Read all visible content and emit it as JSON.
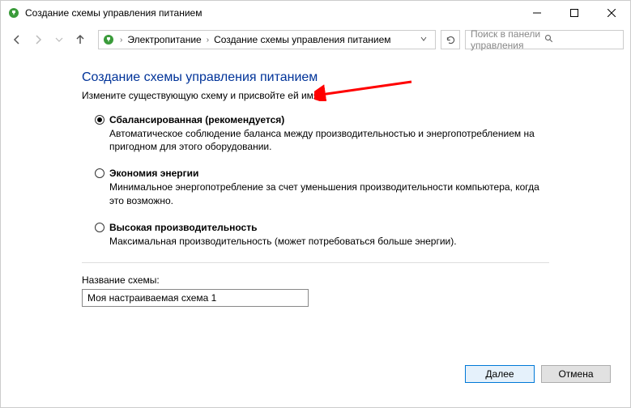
{
  "window": {
    "title": "Создание схемы управления питанием"
  },
  "breadcrumb": {
    "item1": "Электропитание",
    "item2": "Создание схемы управления питанием"
  },
  "search": {
    "placeholder": "Поиск в панели управления"
  },
  "page": {
    "title": "Создание схемы управления питанием",
    "subtitle": "Измените существующую схему и присвойте ей имя."
  },
  "plans": [
    {
      "name": "Сбалансированная (рекомендуется)",
      "desc": "Автоматическое соблюдение баланса между производительностью и энергопотреблением на пригодном для этого оборудовании.",
      "checked": true
    },
    {
      "name": "Экономия энергии",
      "desc": "Минимальное энергопотребление за счет уменьшения производительности компьютера, когда это возможно.",
      "checked": false
    },
    {
      "name": "Высокая производительность",
      "desc": "Максимальная производительность (может потребоваться больше энергии).",
      "checked": false
    }
  ],
  "schemeName": {
    "label": "Название схемы:",
    "value": "Моя настраиваемая схема 1"
  },
  "buttons": {
    "next": "Далее",
    "cancel": "Отмена"
  }
}
